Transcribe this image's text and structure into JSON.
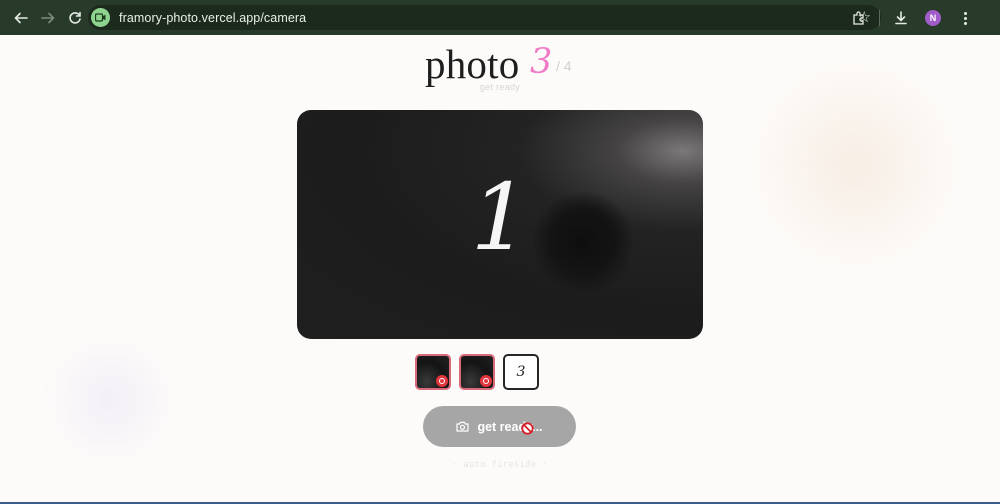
{
  "browser": {
    "url": "framory-photo.vercel.app/camera",
    "profile_initial": "N",
    "back_icon": "arrow-left-icon",
    "forward_icon": "arrow-right-icon",
    "reload_icon": "reload-icon"
  },
  "header": {
    "title_word": "photo",
    "current_shot": "3",
    "total_shots": "/ 4",
    "status": "get ready"
  },
  "camera": {
    "countdown": "1"
  },
  "thumbnails": {
    "placeholder_number": "3"
  },
  "capture": {
    "label": "get ready..."
  },
  "hint": "· auto fireside ·",
  "colors": {
    "accent_pink": "#f07cc8",
    "browser_frame": "#283a2a",
    "button_disabled": "#a6a6a6",
    "thumb_border": "#d96a7a"
  }
}
